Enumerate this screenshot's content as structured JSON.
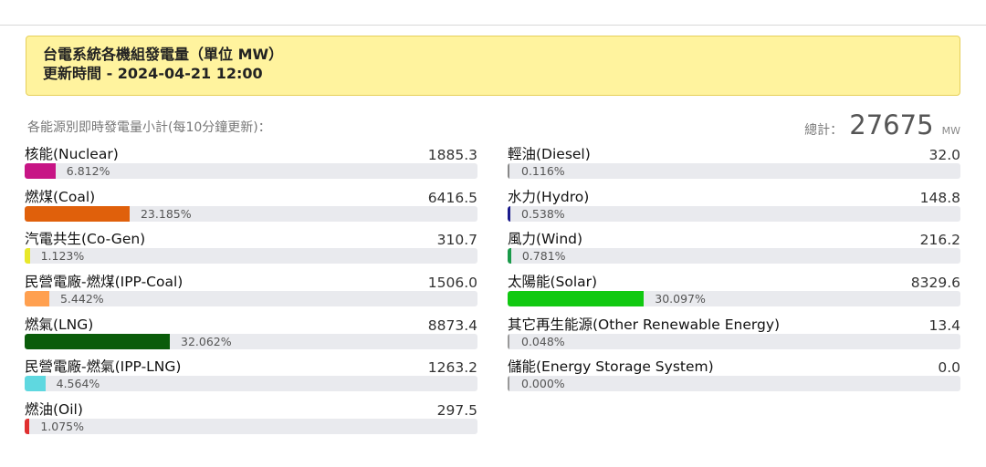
{
  "header": {
    "title": "台電系統各機組發電量（單位 MW）",
    "updated": "更新時間 - 2024-04-21 12:00"
  },
  "subtitle": "各能源別即時發電量小計(每10分鐘更新)：",
  "total": {
    "label": "總計：",
    "value": "27675",
    "unit": "MW"
  },
  "left_items": [
    {
      "name": "核能(Nuclear)",
      "value": "1885.3",
      "percent": "6.812%",
      "pct": 6.812,
      "color": "#c71585"
    },
    {
      "name": "燃煤(Coal)",
      "value": "6416.5",
      "percent": "23.185%",
      "pct": 23.185,
      "color": "#e0600b"
    },
    {
      "name": "汽電共生(Co-Gen)",
      "value": "310.7",
      "percent": "1.123%",
      "pct": 1.123,
      "color": "#e8e82a"
    },
    {
      "name": "民營電廠-燃煤(IPP-Coal)",
      "value": "1506.0",
      "percent": "5.442%",
      "pct": 5.442,
      "color": "#ffa050"
    },
    {
      "name": "燃氣(LNG)",
      "value": "8873.4",
      "percent": "32.062%",
      "pct": 32.062,
      "color": "#0a5c0a"
    },
    {
      "name": "民營電廠-燃氣(IPP-LNG)",
      "value": "1263.2",
      "percent": "4.564%",
      "pct": 4.564,
      "color": "#5fd8e0"
    },
    {
      "name": "燃油(Oil)",
      "value": "297.5",
      "percent": "1.075%",
      "pct": 1.075,
      "color": "#e03030"
    }
  ],
  "right_items": [
    {
      "name": "輕油(Diesel)",
      "value": "32.0",
      "percent": "0.116%",
      "pct": 0.116,
      "color": "#888888"
    },
    {
      "name": "水力(Hydro)",
      "value": "148.8",
      "percent": "0.538%",
      "pct": 0.538,
      "color": "#1a1a8c"
    },
    {
      "name": "風力(Wind)",
      "value": "216.2",
      "percent": "0.781%",
      "pct": 0.781,
      "color": "#1a9a4a"
    },
    {
      "name": "太陽能(Solar)",
      "value": "8329.6",
      "percent": "30.097%",
      "pct": 30.097,
      "color": "#11c911"
    },
    {
      "name": "其它再生能源(Other Renewable Energy)",
      "value": "13.4",
      "percent": "0.048%",
      "pct": 0.048,
      "color": "#999999"
    },
    {
      "name": "儲能(Energy Storage System)",
      "value": "0.0",
      "percent": "0.000%",
      "pct": 0.0,
      "color": "#999999"
    }
  ]
}
